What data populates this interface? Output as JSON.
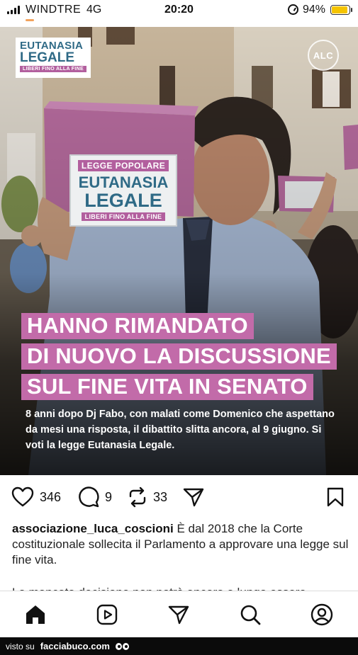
{
  "status_bar": {
    "carrier": "WINDTRE",
    "network": "4G",
    "time": "20:20",
    "battery_percent": "94%",
    "battery_color": "#f5c400"
  },
  "post": {
    "brand_logo": {
      "line1": "EUTANASIA",
      "line2": "LEGALE",
      "tagline": "LIBERI FINO ALLA FINE"
    },
    "alc_badge": "ALC",
    "box_label": {
      "top": "LEGGE POPOLARE",
      "line1": "EUTANASIA",
      "line2": "LEGALE",
      "bottom": "LIBERI FINO ALLA FINE"
    },
    "headline_lines": [
      "HANNO RIMANDATO",
      "DI NUOVO LA DISCUSSIONE",
      "SUL FINE VITA IN SENATO"
    ],
    "subtext": "8 anni dopo Dj Fabo, con malati come Domenico che aspettano da mesi una risposta, il dibattito slitta ancora, al 9 giugno. Si voti la legge Eutanasia Legale.",
    "accent_color": "#c26ba9",
    "brand_blue": "#2f6a86"
  },
  "actions": {
    "likes": "346",
    "comments": "9",
    "reposts": "33",
    "icons": [
      "heart-icon",
      "comment-icon",
      "repost-icon",
      "share-icon",
      "bookmark-icon"
    ]
  },
  "caption": {
    "username": "associazione_luca_coscioni",
    "text": " È dal 2018 che la Corte costituzionale sollecita il Parlamento a approvare una legge sul fine vita.",
    "cut_line": "La mancata decisione non potrà ancora a lungo essere sostenibile, e per il dibattito della"
  },
  "nav": {
    "items": [
      "home-icon",
      "reels-icon",
      "send-icon",
      "search-icon",
      "profile-icon"
    ]
  },
  "footer": {
    "prefix": "visto su",
    "site": "facciabuco.com"
  }
}
